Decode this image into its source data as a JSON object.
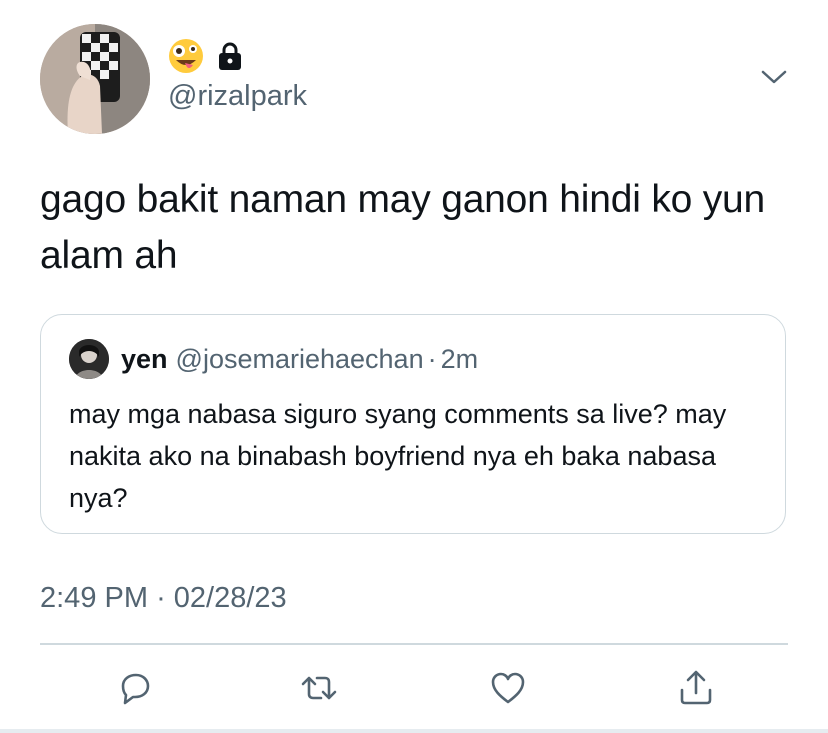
{
  "tweet": {
    "author": {
      "handle": "@rizalpark",
      "badges": [
        "zany-face-emoji",
        "lock-icon"
      ]
    },
    "text": "gago bakit naman may ganon hindi ko yun alam ah",
    "timestamp": "2:49 PM",
    "date": "02/28/23",
    "meta_separator": "·"
  },
  "quote": {
    "name": "yen",
    "handle": "@josemariehaechan",
    "separator": "·",
    "time": "2m",
    "text": "may mga nabasa siguro syang comments sa live? may nakita ako na binabash boyfriend nya eh baka nabasa nya?"
  },
  "actions": [
    "reply-icon",
    "retweet-icon",
    "like-icon",
    "share-icon"
  ],
  "colors": {
    "text": "#0f1419",
    "secondary": "#536471",
    "border": "#cfd9de"
  }
}
